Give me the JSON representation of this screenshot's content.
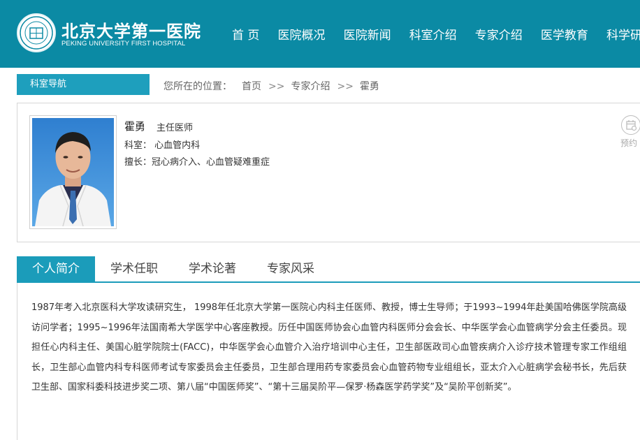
{
  "header": {
    "logo_cn": "北京大学第一医院",
    "logo_en": "PEKING UNIVERSITY FIRST HOSPITAL",
    "nav": [
      "首 页",
      "医院概况",
      "医院新闻",
      "科室介绍",
      "专家介绍",
      "医学教育",
      "科学研究"
    ]
  },
  "breadcrumb": {
    "dept_nav": "科室导航",
    "location_label": "您所在的位置：",
    "items": [
      "首页",
      "专家介绍",
      "霍勇"
    ],
    "separator": ">>"
  },
  "doctor": {
    "name": "霍勇",
    "title": "主任医师",
    "department_label": "科室：",
    "department": "心血管内科",
    "specialty_label": "擅长：",
    "specialty": "冠心病介入、心血管疑难重症",
    "booking_label": "预约"
  },
  "tabs": {
    "items": [
      "个人简介",
      "学术任职",
      "学术论著",
      "专家风采"
    ],
    "active": "个人简介"
  },
  "bio": {
    "text": "1987年考入北京医科大学攻读研究生， 1998年任北京大学第一医院心内科主任医师、教授，博士生导师；于1993~1994年赴美国哈佛医学院高级访问学者；1995~1996年法国南希大学医学中心客座教授。历任中国医师协会心血管内科医师分会会长、中华医学会心血管病学分会主任委员。现担任心内科主任、美国心脏学院院士(FACC)，中华医学会心血管介入治疗培训中心主任，卫生部医政司心血管疾病介入诊疗技术管理专家工作组组长，卫生部心血管内科专科医师考试专家委员会主任委员，卫生部合理用药专家委员会心血管药物专业组组长，亚太介入心脏病学会秘书长，先后获卫生部、国家科委科技进步奖二项、第八届“中国医师奖”、“第十三届吴阶平—保罗·杨森医学药学奖”及“吴阶平创新奖”。"
  },
  "colors": {
    "header_bg": "#0b8aa4",
    "accent": "#1b9cba",
    "dept_nav_bg": "#1e9fbd"
  }
}
